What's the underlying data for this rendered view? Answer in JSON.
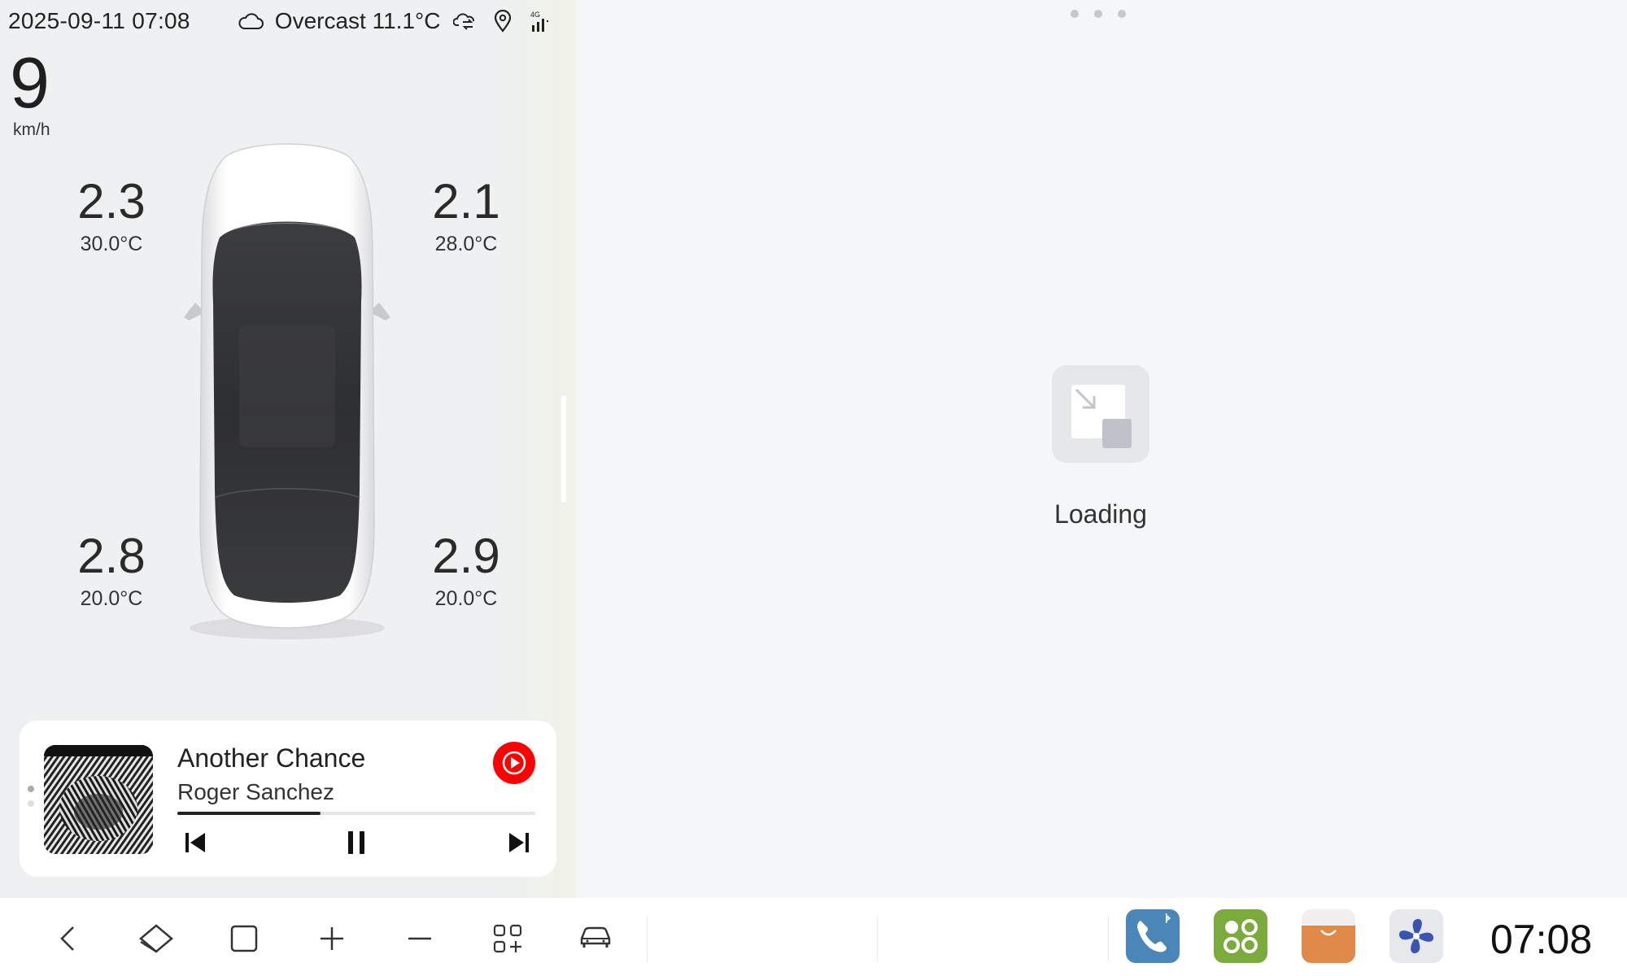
{
  "status_bar": {
    "datetime": "2025-09-11 07:08",
    "weather": "Overcast 11.1°C",
    "network": "4G"
  },
  "speed": {
    "value": "9",
    "unit": "km/h"
  },
  "tires": {
    "front_left": {
      "pressure": "2.3",
      "temp": "30.0°C"
    },
    "front_right": {
      "pressure": "2.1",
      "temp": "28.0°C"
    },
    "rear_left": {
      "pressure": "2.8",
      "temp": "20.0°C"
    },
    "rear_right": {
      "pressure": "2.9",
      "temp": "20.0°C"
    }
  },
  "media": {
    "title": "Another Chance",
    "artist": "Roger Sanchez",
    "progress": 0.4,
    "source_icon": "youtube-music-icon"
  },
  "main": {
    "loading_label": "Loading"
  },
  "dock": {
    "nav_buttons": [
      "back-icon",
      "home-icon",
      "recents-icon",
      "volume-up-icon",
      "volume-down-icon",
      "apps-add-icon",
      "car-icon"
    ],
    "apps": [
      "phone-bluetooth-icon",
      "app-grid-icon",
      "store-icon",
      "fan-icon"
    ],
    "clock": "07:08"
  },
  "colors": {
    "accent_youtube": "#ff0000",
    "phone_app": "#4a86b8",
    "grid_app": "#7bab3c",
    "store_app": "#e08a4a",
    "fan_app": "#3b54b4"
  }
}
